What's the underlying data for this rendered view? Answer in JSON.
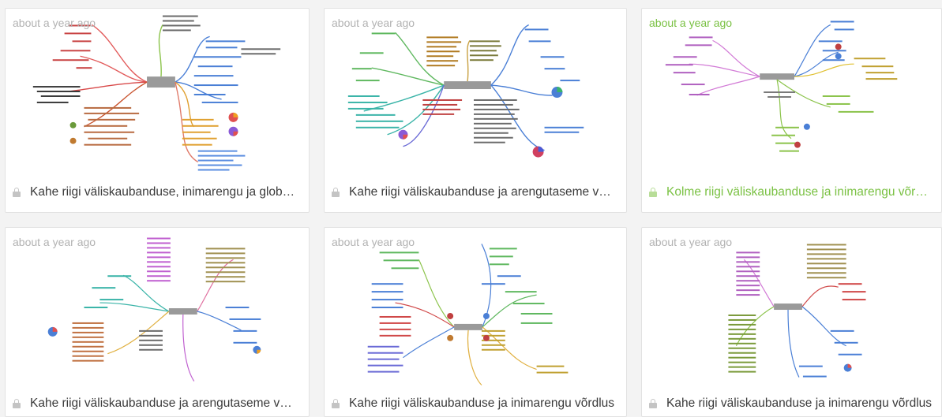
{
  "cards": [
    {
      "timestamp": "about a year ago",
      "title": "Kahe riigi väliskaubanduse, inimarengu ja glob…",
      "locked": true,
      "active": false
    },
    {
      "timestamp": "about a year ago",
      "title": "Kahe riigi väliskaubanduse ja arengutaseme v…",
      "locked": true,
      "active": false
    },
    {
      "timestamp": "about a year ago",
      "title": "Kolme riigi väliskaubanduse ja inimarengu võr…",
      "locked": true,
      "active": true
    },
    {
      "timestamp": "about a year ago",
      "title": "Kahe riigi väliskaubanduse ja arengutaseme v…",
      "locked": true,
      "active": false
    },
    {
      "timestamp": "about a year ago",
      "title": "Kahe riigi väliskaubanduse ja inimarengu võrdlus",
      "locked": true,
      "active": false
    },
    {
      "timestamp": "about a year ago",
      "title": "Kahe riigi väliskaubanduse ja inimarengu võrdlus",
      "locked": true,
      "active": false
    }
  ],
  "colors": {
    "timestamp": "#b2b2b2",
    "active_accent": "#7ac143",
    "title": "#3a3a3a",
    "card_border": "#e2e2e2",
    "page_bg": "#f3f3f3"
  }
}
